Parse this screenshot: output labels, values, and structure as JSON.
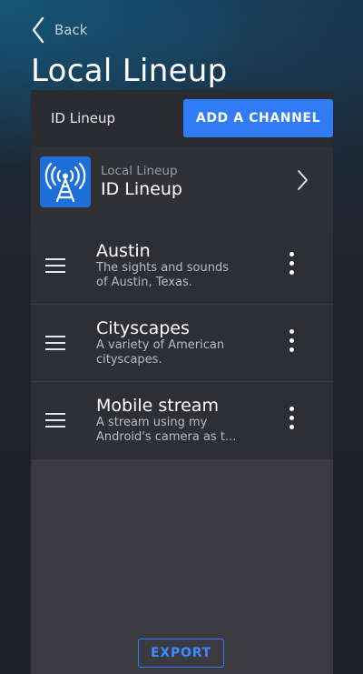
{
  "nav": {
    "back_label": "Back"
  },
  "page": {
    "title": "Local Lineup"
  },
  "header": {
    "label": "ID Lineup",
    "add_channel_label": "ADD A CHANNEL"
  },
  "lineup_card": {
    "subtitle": "Local Lineup",
    "name": "ID Lineup",
    "icon": "broadcast-tower-icon"
  },
  "channels": [
    {
      "name": "Austin",
      "description": "The sights and sounds of Austin, Texas."
    },
    {
      "name": "Cityscapes",
      "description": "A variety of American cityscapes."
    },
    {
      "name": "Mobile stream",
      "description": "A stream using my Android's camera as t..."
    }
  ],
  "footer": {
    "export_label": "EXPORT"
  },
  "colors": {
    "accent": "#2f7cf6",
    "panel": "#3a3a40",
    "row": "#2e2f34"
  }
}
